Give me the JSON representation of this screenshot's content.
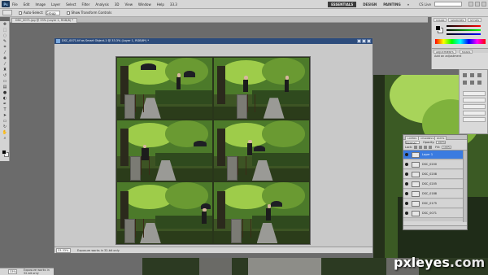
{
  "menubar": {
    "logo": "Ps",
    "items": [
      "File",
      "Edit",
      "Image",
      "Layer",
      "Select",
      "Filter",
      "Analysis",
      "3D",
      "View",
      "Window",
      "Help"
    ],
    "zoom": "33.3",
    "workspaces": [
      "ESSENTIALS",
      "DESIGN",
      "PAINTING"
    ],
    "active_workspace": "ESSENTIALS",
    "more": "»",
    "cs_live": "CS Live"
  },
  "options": {
    "auto_select_label": "Auto-Select:",
    "auto_select_value": "Group",
    "show_transform_label": "Show Transform Controls"
  },
  "document": {
    "tab_title": "DSC_0071.jpg @ 33% (Layer 1, RGB/8) *",
    "window_title": "DSC_0071.tif as Smart Object-1 @ 33.3% (Layer 1, RGB/8*) *",
    "zoom": "33.33%",
    "status": "Exposure works in 32-bit only"
  },
  "panels": {
    "color_tabs": [
      "COLOR",
      "SWATCHES",
      "STYLES"
    ],
    "adjust_tabs": [
      "ADJUSTMENTS",
      "MASKS"
    ],
    "adjust_label": "Add an adjustment"
  },
  "layers": {
    "tabs": [
      "LAYERS",
      "CHANNELS",
      "PATHS"
    ],
    "blend_mode": "Normal",
    "opacity_label": "Opacity:",
    "opacity": "100%",
    "lock_label": "Lock:",
    "fill_label": "Fill:",
    "fill": "100%",
    "items": [
      {
        "name": "Layer 1",
        "selected": true
      },
      {
        "name": "DSC_0200",
        "selected": false
      },
      {
        "name": "DSC_0208",
        "selected": false
      },
      {
        "name": "DSC_0205",
        "selected": false
      },
      {
        "name": "DSC_0188",
        "selected": false
      },
      {
        "name": "DSC_0175",
        "selected": false
      },
      {
        "name": "DSC_0071",
        "selected": false
      }
    ]
  },
  "app_status": {
    "zoom": "33%",
    "status": "Exposure works in 32-bit only"
  },
  "watermark": {
    "brand": "pxleyes",
    "tld": ".com"
  }
}
